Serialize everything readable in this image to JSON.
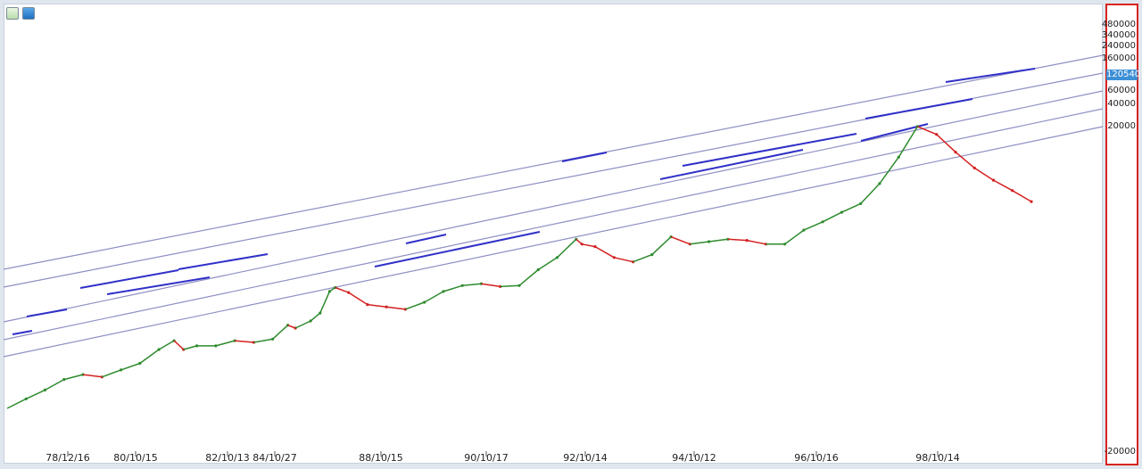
{
  "toolbar": {
    "pencil_icon": "pencil-icon",
    "down_icon": "arrow-down-icon"
  },
  "colors": {
    "channel": "#8f8fc4",
    "segment": "#3030c8",
    "up": "#2e8b2e",
    "down": "#d42020",
    "price_tag": "#3d8fd6"
  },
  "chart_data": {
    "type": "line",
    "y_scale": "log",
    "x_tick_labels": [
      "78/12/16",
      "80/10/15",
      "82/10/13",
      "84/10/27",
      "88/10/15",
      "90/10/17",
      "92/10/14",
      "94/10/12",
      "96/10/16",
      "98/10/14"
    ],
    "y_tick_labels": [
      "480000",
      "340000",
      "240000",
      "160000",
      "120540",
      "60000",
      "40000",
      "20000",
      "-20000"
    ],
    "current_price": "120540",
    "ylim": [
      13000,
      600000
    ],
    "grid": false,
    "series": [
      {
        "values": [
          {
            "x": 0.0,
            "y": 14500
          },
          {
            "x": 1.0,
            "y": 16000
          },
          {
            "x": 2.0,
            "y": 17500
          },
          {
            "x": 3.0,
            "y": 19500
          },
          {
            "x": 4.0,
            "y": 20500
          },
          {
            "x": 5.0,
            "y": 20000
          },
          {
            "x": 6.0,
            "y": 21500
          },
          {
            "x": 7.0,
            "y": 23000
          },
          {
            "x": 8.0,
            "y": 26500
          },
          {
            "x": 8.8,
            "y": 29000
          },
          {
            "x": 9.3,
            "y": 26500
          },
          {
            "x": 10.0,
            "y": 27500
          },
          {
            "x": 11.0,
            "y": 27500
          },
          {
            "x": 12.0,
            "y": 29000
          },
          {
            "x": 13.0,
            "y": 28500
          },
          {
            "x": 14.0,
            "y": 29500
          },
          {
            "x": 14.8,
            "y": 34000
          },
          {
            "x": 15.2,
            "y": 33000
          },
          {
            "x": 16.0,
            "y": 35500
          },
          {
            "x": 16.5,
            "y": 38500
          },
          {
            "x": 17.0,
            "y": 48000
          },
          {
            "x": 17.3,
            "y": 50000
          },
          {
            "x": 18.0,
            "y": 47500
          },
          {
            "x": 19.0,
            "y": 42000
          },
          {
            "x": 20.0,
            "y": 41000
          },
          {
            "x": 21.0,
            "y": 40000
          },
          {
            "x": 22.0,
            "y": 43000
          },
          {
            "x": 23.0,
            "y": 48000
          },
          {
            "x": 24.0,
            "y": 51000
          },
          {
            "x": 25.0,
            "y": 52000
          },
          {
            "x": 26.0,
            "y": 50500
          },
          {
            "x": 27.0,
            "y": 51000
          },
          {
            "x": 28.0,
            "y": 60000
          },
          {
            "x": 29.0,
            "y": 68000
          },
          {
            "x": 30.0,
            "y": 82000
          },
          {
            "x": 30.3,
            "y": 78000
          },
          {
            "x": 31.0,
            "y": 76000
          },
          {
            "x": 32.0,
            "y": 68000
          },
          {
            "x": 33.0,
            "y": 65000
          },
          {
            "x": 34.0,
            "y": 70000
          },
          {
            "x": 35.0,
            "y": 84000
          },
          {
            "x": 36.0,
            "y": 78000
          },
          {
            "x": 37.0,
            "y": 80000
          },
          {
            "x": 38.0,
            "y": 82000
          },
          {
            "x": 39.0,
            "y": 81000
          },
          {
            "x": 40.0,
            "y": 78000
          },
          {
            "x": 41.0,
            "y": 78000
          },
          {
            "x": 42.0,
            "y": 90000
          },
          {
            "x": 43.0,
            "y": 98000
          },
          {
            "x": 44.0,
            "y": 108000
          },
          {
            "x": 45.0,
            "y": 118000
          },
          {
            "x": 46.0,
            "y": 145000
          },
          {
            "x": 47.0,
            "y": 190000
          },
          {
            "x": 48.0,
            "y": 260000
          },
          {
            "x": 49.0,
            "y": 240000
          },
          {
            "x": 50.0,
            "y": 200000
          },
          {
            "x": 51.0,
            "y": 170000
          },
          {
            "x": 52.0,
            "y": 150000
          },
          {
            "x": 53.0,
            "y": 135000
          },
          {
            "x": 54.0,
            "y": 120540
          }
        ]
      }
    ]
  }
}
